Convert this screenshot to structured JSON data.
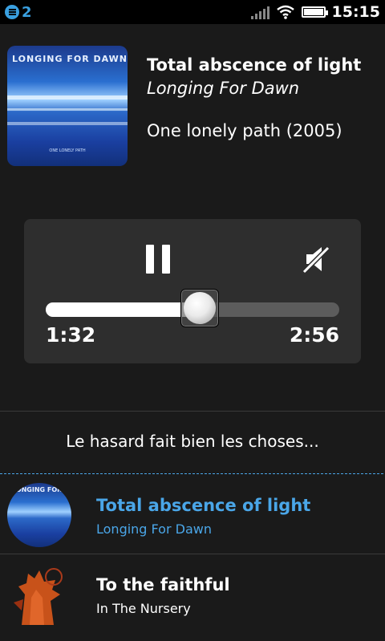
{
  "status_bar": {
    "notification_count": "2",
    "time": "15:15",
    "icons": [
      "notification-icon",
      "signal-icon",
      "wifi-icon",
      "battery-icon"
    ]
  },
  "now_playing": {
    "cover_logo_text": "LONGING FOR DAWN",
    "cover_subtitle": "ONE LONELY PATH",
    "title": "Total abscence of light",
    "artist": "Longing For Dawn",
    "album": "One lonely path (2005)"
  },
  "player": {
    "elapsed": "1:32",
    "total": "2:56",
    "progress": 0.523,
    "icons": [
      "pause-icon",
      "mute-icon"
    ]
  },
  "shuffle_message": "Le hasard fait bien les choses...",
  "playlist": [
    {
      "title": "Total abscence of light",
      "artist": "Longing For Dawn",
      "active": true
    },
    {
      "title": "To the faithful",
      "artist": "In The Nursery",
      "active": false
    }
  ],
  "colors": {
    "accent": "#4aa6e8",
    "background": "#1a1a1a",
    "panel": "#2e2e2e"
  }
}
